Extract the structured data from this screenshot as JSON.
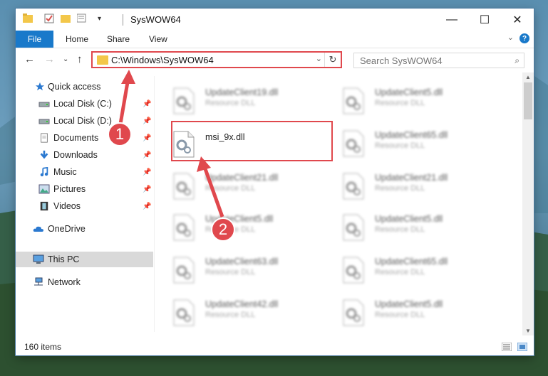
{
  "window": {
    "title": "SysWOW64",
    "controls": {
      "minimize": "—",
      "maximize": "☐",
      "close": "✕"
    }
  },
  "ribbon": {
    "tabs": [
      "File",
      "Home",
      "Share",
      "View"
    ],
    "help": "?"
  },
  "nav": {
    "address": "C:\\Windows\\SysWOW64",
    "search_placeholder": "Search SysWOW64"
  },
  "sidebar": {
    "items": [
      {
        "label": "Quick access",
        "icon": "star-icon"
      },
      {
        "label": "Local Disk (C:)",
        "icon": "drive-icon"
      },
      {
        "label": "Local Disk (D:)",
        "icon": "drive-icon"
      },
      {
        "label": "Documents",
        "icon": "documents-icon"
      },
      {
        "label": "Downloads",
        "icon": "download-icon"
      },
      {
        "label": "Music",
        "icon": "music-icon"
      },
      {
        "label": "Pictures",
        "icon": "pictures-icon"
      },
      {
        "label": "Videos",
        "icon": "videos-icon"
      },
      {
        "label": "OneDrive",
        "icon": "cloud-icon"
      },
      {
        "label": "This PC",
        "icon": "computer-icon"
      },
      {
        "label": "Network",
        "icon": "network-icon"
      }
    ]
  },
  "files": {
    "left": [
      {
        "name": "UpdateClient19.dll",
        "type": "Resource DLL"
      },
      {
        "name": "msi_9x.dll",
        "type": ""
      },
      {
        "name": "UpdateClient21.dll",
        "type": "Resource DLL"
      },
      {
        "name": "UpdateClient5.dll",
        "type": "Resource DLL"
      },
      {
        "name": "UpdateClient63.dll",
        "type": "Resource DLL"
      },
      {
        "name": "UpdateClient42.dll",
        "type": "Resource DLL"
      }
    ],
    "right": [
      {
        "name": "UpdateClient5.dll",
        "type": "Resource DLL"
      },
      {
        "name": "UpdateClient65.dll",
        "type": "Resource DLL"
      },
      {
        "name": "UpdateClient21.dll",
        "type": "Resource DLL"
      },
      {
        "name": "UpdateClient5.dll",
        "type": "Resource DLL"
      },
      {
        "name": "UpdateClient65.dll",
        "type": "Resource DLL"
      },
      {
        "name": "UpdateClient5.dll",
        "type": "Resource DLL"
      }
    ]
  },
  "status": {
    "count": "160 items"
  },
  "callouts": [
    "1",
    "2"
  ],
  "colors": {
    "accent": "#1979ca",
    "highlight": "#e0484d"
  }
}
